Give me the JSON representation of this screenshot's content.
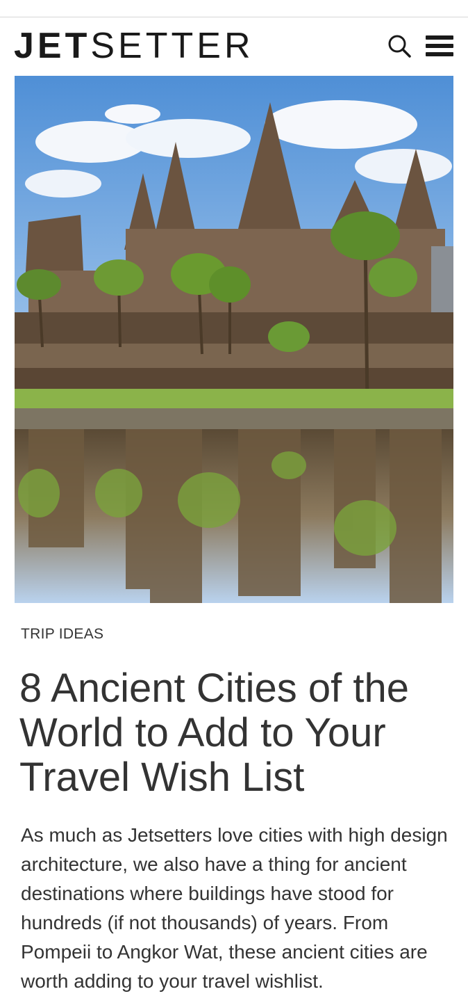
{
  "header": {
    "logo_bold": "JET",
    "logo_light": "SETTER",
    "search_icon": "search-icon",
    "menu_icon": "hamburger-menu-icon"
  },
  "article": {
    "category": "TRIP IDEAS",
    "title": "8 Ancient Cities of the World to Add to Your Travel Wish List",
    "intro": "As much as Jetsetters love cities with high design architecture, we also have a thing for ancient destinations where buildings have stood for hundreds (if not thousands) of years. From Pompeii to Angkor Wat, these ancient cities are worth adding to your travel wishlist."
  },
  "colors": {
    "text": "#333333",
    "logo": "#1a1a1a",
    "sky": "#6ea6e0",
    "temple": "#6b5440",
    "grass": "#8bb34a"
  }
}
